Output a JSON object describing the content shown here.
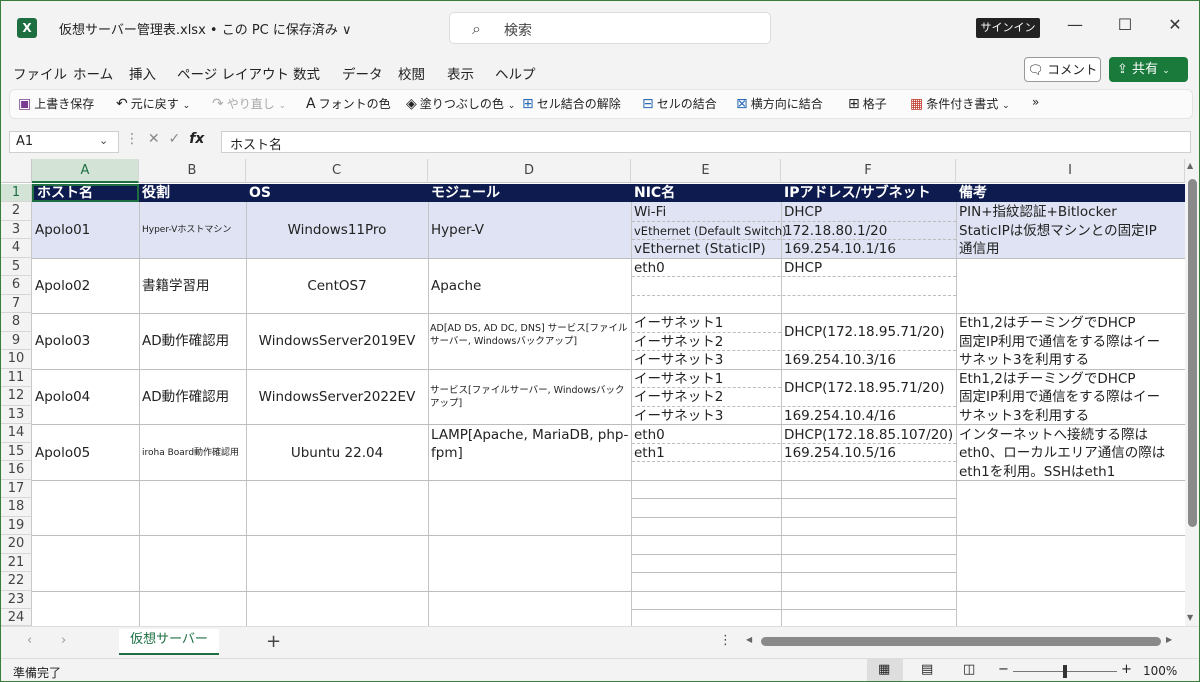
{
  "window": {
    "title": "仮想サーバー管理表.xlsx • この PC に保存済み ∨",
    "search_placeholder": "検索",
    "signin": "サインイン"
  },
  "menu": [
    "ファイル",
    "ホーム",
    "挿入",
    "ページ レイアウト",
    "数式",
    "データ",
    "校閲",
    "表示",
    "ヘルプ"
  ],
  "actions": {
    "comment": "コメント",
    "share": "共有"
  },
  "ribbon": [
    {
      "label": "上書き保存",
      "icon": "save-icon"
    },
    {
      "label": "元に戻す",
      "icon": "undo-icon"
    },
    {
      "label": "やり直し",
      "icon": "redo-icon"
    },
    {
      "label": "フォントの色",
      "icon": "font-color-icon"
    },
    {
      "label": "塗りつぶしの色",
      "icon": "fill-color-icon"
    },
    {
      "label": "セル結合の解除",
      "icon": "unmerge-icon"
    },
    {
      "label": "セルの結合",
      "icon": "merge-icon"
    },
    {
      "label": "横方向に結合",
      "icon": "merge-across-icon"
    },
    {
      "label": "格子",
      "icon": "borders-icon"
    },
    {
      "label": "条件付き書式",
      "icon": "conditional-format-icon"
    }
  ],
  "formula_bar": {
    "name_box": "A1",
    "formula": "ホスト名"
  },
  "columns": [
    "A",
    "B",
    "C",
    "D",
    "E",
    "F",
    "I"
  ],
  "rows": [
    "1",
    "2",
    "3",
    "4",
    "5",
    "6",
    "7",
    "8",
    "9",
    "10",
    "11",
    "12",
    "13",
    "14",
    "15",
    "16",
    "17",
    "18",
    "19",
    "20",
    "21",
    "22",
    "23",
    "24"
  ],
  "header_row": [
    "ホスト名",
    "役割",
    "OS",
    "モジュール",
    "NIC名",
    "IPアドレス/サブネット",
    "備考"
  ],
  "hosts": [
    {
      "host": "Apolo01",
      "role": "Hyper-Vホストマシン",
      "os": "Windows11Pro",
      "module": "Hyper-V",
      "nics": [
        "Wi-Fi",
        "vEthernet (Default Switch)",
        "vEthernet (StaticIP)"
      ],
      "ips": [
        "DHCP",
        "172.18.80.1/20",
        "169.254.10.1/16"
      ],
      "notes": [
        "PIN+指紋認証+Bitlocker",
        "StaticIPは仮想マシンとの固定IP",
        "通信用"
      ]
    },
    {
      "host": "Apolo02",
      "role": "書籍学習用",
      "os": "CentOS7",
      "module": "Apache",
      "nics": [
        "eth0",
        "",
        ""
      ],
      "ips": [
        "DHCP",
        "",
        ""
      ],
      "notes": [
        "",
        "",
        ""
      ]
    },
    {
      "host": "Apolo03",
      "role": "AD動作確認用",
      "os": "WindowsServer2019EV",
      "module": "AD[AD DS, AD DC, DNS] サービス[ファイルサーバー, Windowsバックアップ]",
      "nics": [
        "イーサネット1",
        "イーサネット2",
        "イーサネット3"
      ],
      "ips": [
        "DHCP(172.18.95.71/20)",
        "",
        "169.254.10.3/16"
      ],
      "notes": [
        "Eth1,2はチーミングでDHCP",
        "固定IP利用で通信をする際はイー",
        "サネット3を利用する"
      ]
    },
    {
      "host": "Apolo04",
      "role": "AD動作確認用",
      "os": "WindowsServer2022EV",
      "module": "サービス[ファイルサーバー, Windowsバックアップ]",
      "nics": [
        "イーサネット1",
        "イーサネット2",
        "イーサネット3"
      ],
      "ips": [
        "DHCP(172.18.95.71/20)",
        "",
        "169.254.10.4/16"
      ],
      "notes": [
        "Eth1,2はチーミングでDHCP",
        "固定IP利用で通信をする際はイー",
        "サネット3を利用する"
      ]
    },
    {
      "host": "Apolo05",
      "role": "iroha Board動作確認用",
      "os": "Ubuntu 22.04",
      "module": "LAMP[Apache, MariaDB, php-fpm]",
      "nics": [
        "eth0",
        "eth1",
        ""
      ],
      "ips": [
        "DHCP(172.18.85.107/20)",
        "169.254.10.5/16",
        ""
      ],
      "notes": [
        "インターネットへ接続する際は",
        "eth0、ローカルエリア通信の際は",
        "eth1を利用。SSHはeth1"
      ]
    }
  ],
  "sheet_tab": "仮想サーバー",
  "status": {
    "ready": "準備完了",
    "zoom": "100%"
  },
  "colors": {
    "header_bg": "#0d1b4e",
    "highlight_row": "#dfe3f3",
    "excel_green": "#1d6f42"
  }
}
